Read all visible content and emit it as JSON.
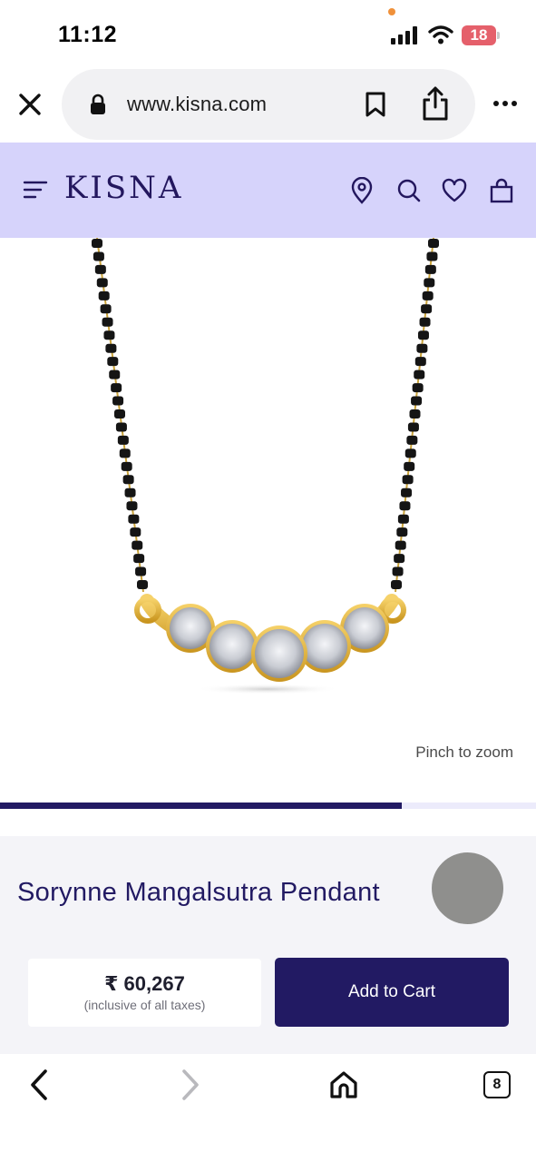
{
  "status_bar": {
    "time": "11:12",
    "battery_level": "18"
  },
  "browser": {
    "url": "www.kisna.com",
    "tabs_count": "8"
  },
  "site": {
    "logo": "KISNA",
    "accent_color": "#221a63",
    "header_bg": "#d6d3fb"
  },
  "gallery": {
    "pinch_hint": "Pinch to zoom",
    "progress_fraction": 0.75
  },
  "product": {
    "title": "Sorynne Mangalsutra Pendant",
    "price": "₹ 60,267",
    "tax_note": "(inclusive of all taxes)",
    "add_to_cart_label": "Add to Cart"
  },
  "icons": {
    "header": [
      "menu-icon",
      "location-pin-icon",
      "search-icon",
      "heart-icon",
      "shopping-bag-icon"
    ],
    "browser": [
      "close-icon",
      "lock-icon",
      "bookmark-icon",
      "share-icon",
      "more-icon"
    ],
    "toolbar": [
      "back-icon",
      "forward-icon",
      "home-icon",
      "tabs-icon"
    ]
  }
}
